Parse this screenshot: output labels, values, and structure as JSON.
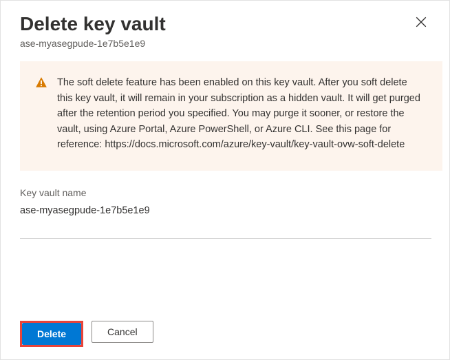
{
  "header": {
    "title": "Delete key vault",
    "subtitle": "ase-myasegpude-1e7b5e1e9"
  },
  "warning": {
    "text": "The soft delete feature has been enabled on this key vault. After you soft delete this key vault, it will remain in your subscription as a hidden vault. It will get purged after the retention period you specified. You may purge it sooner, or restore the vault, using Azure Portal, Azure PowerShell, or Azure CLI. See this page for reference: https://docs.microsoft.com/azure/key-vault/key-vault-ovw-soft-delete"
  },
  "field": {
    "label": "Key vault name",
    "value": "ase-myasegpude-1e7b5e1e9"
  },
  "buttons": {
    "delete": "Delete",
    "cancel": "Cancel"
  },
  "colors": {
    "primary": "#0078d4",
    "warningIcon": "#d87a00",
    "warningBg": "#fdf4ed",
    "highlight": "#e8443a"
  }
}
